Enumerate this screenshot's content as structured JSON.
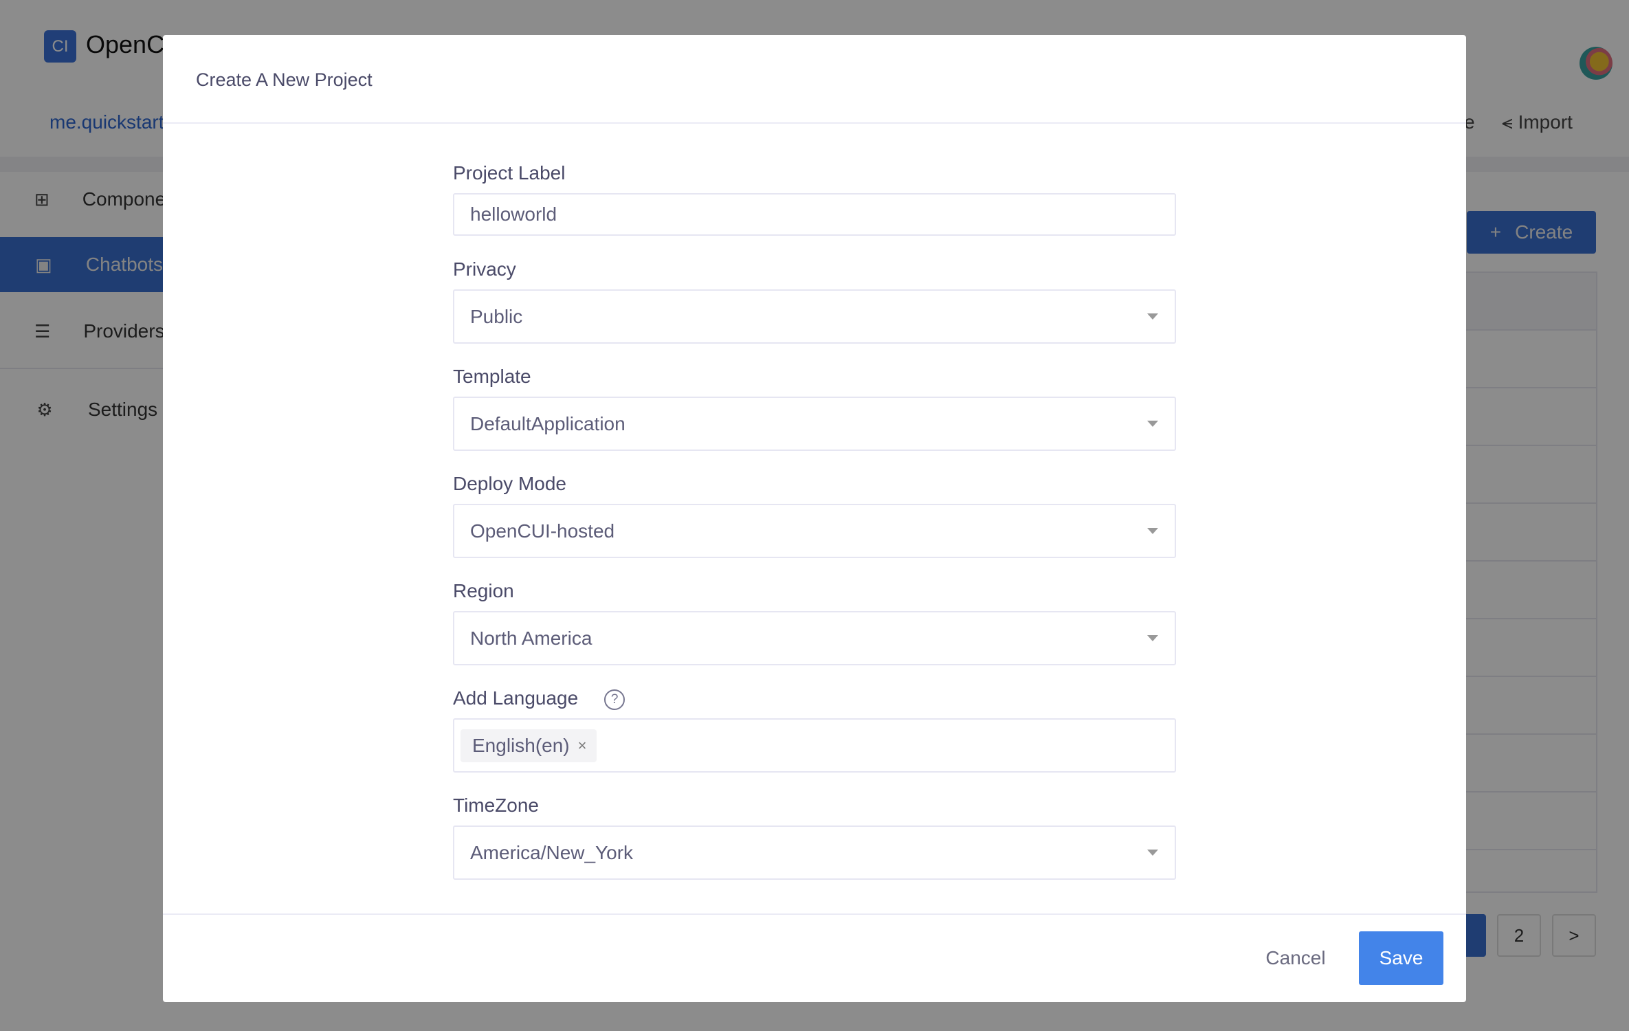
{
  "app": {
    "brand": "OpenCUI",
    "logo_text": "CI",
    "project": "me.quickstart",
    "toolbar_partial": "e",
    "import_label": "Import"
  },
  "sidebar": {
    "items": [
      {
        "label": "Components",
        "icon": "components-icon"
      },
      {
        "label": "Chatbots",
        "icon": "chatbot-icon",
        "active": true
      },
      {
        "label": "Providers",
        "icon": "providers-icon"
      },
      {
        "label": "Settings",
        "icon": "gear-icon"
      }
    ]
  },
  "main": {
    "create_label": "Create",
    "pagination": {
      "page2": "2",
      "next": ">"
    }
  },
  "modal": {
    "title": "Create A New Project",
    "fields": {
      "project_label": {
        "label": "Project Label",
        "value": "helloworld"
      },
      "privacy": {
        "label": "Privacy",
        "value": "Public"
      },
      "template": {
        "label": "Template",
        "value": "DefaultApplication"
      },
      "deploy_mode": {
        "label": "Deploy Mode",
        "value": "OpenCUI-hosted"
      },
      "region": {
        "label": "Region",
        "value": "North America"
      },
      "language": {
        "label": "Add Language",
        "help": "?",
        "tags": [
          "English(en)"
        ],
        "remove": "×"
      },
      "timezone": {
        "label": "TimeZone",
        "value": "America/New_York"
      }
    },
    "cancel_label": "Cancel",
    "save_label": "Save"
  },
  "colors": {
    "primary": "#4384e9",
    "sidebar_active": "#3a6fd0",
    "overlay": "rgba(0,0,0,0.45)"
  }
}
